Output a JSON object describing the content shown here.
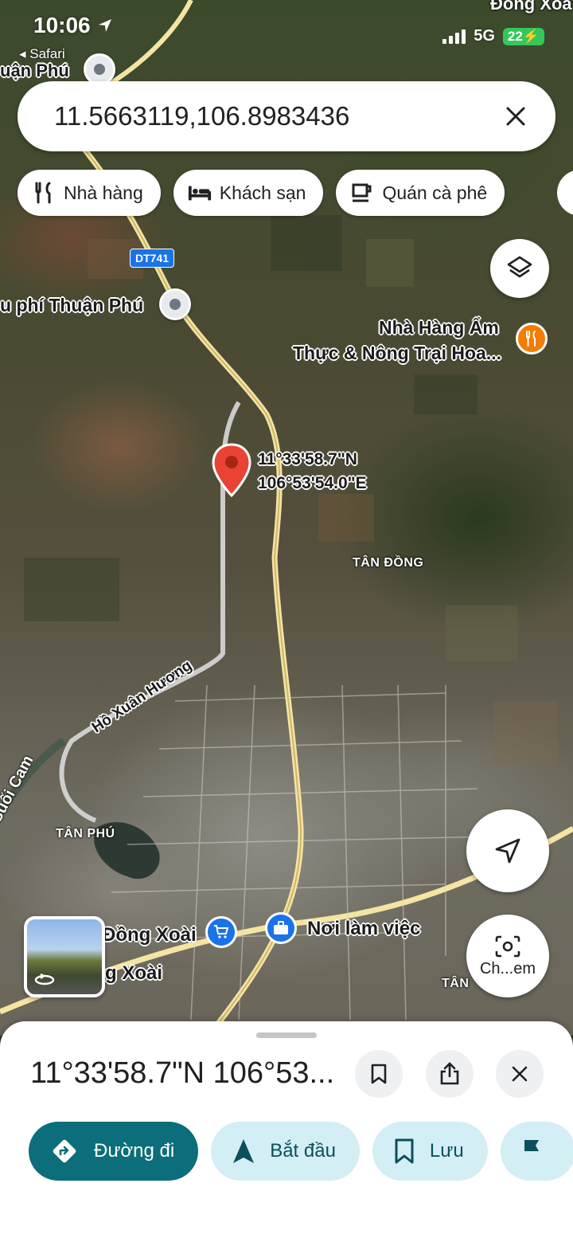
{
  "status_bar": {
    "time": "10:06",
    "back_app": "◂ Safari",
    "network": "5G",
    "battery": "22"
  },
  "search": {
    "value": "11.5663119,106.8983436"
  },
  "chips": [
    {
      "label": "Nhà hàng",
      "icon": "restaurant-icon"
    },
    {
      "label": "Khách sạn",
      "icon": "hotel-icon"
    },
    {
      "label": "Quán cà phê",
      "icon": "coffee-icon"
    }
  ],
  "map": {
    "labels": {
      "top_left_place": "uận Phú",
      "top_right_place": "Đồng Xoà",
      "toll": "u phí Thuận Phú",
      "restaurant_line1": "Nhà Hàng Ẩm",
      "restaurant_line2": "Thực & Nông Trại Hoa...",
      "road_shield": "DT741",
      "area_tan_dong": "TÂN ĐỒNG",
      "street_ho_xuan_huong": "Hồ Xuân Hương",
      "river": "Suối Cam",
      "area_tan_phu": "TÂN PHÚ",
      "dong_xoai_1": "Đồng Xoài",
      "dong_xoai_2": "g Xoài",
      "workplace": "Nơi làm việc",
      "area_tan_right": "TÂN"
    },
    "pin": {
      "lat": "11°33'58.7\"N",
      "lng": "106°53'54.0\"E"
    },
    "lens_label": "Ch...em"
  },
  "sheet": {
    "title": "11°33'58.7\"N 106°53...",
    "actions": [
      {
        "label": "Đường đi"
      },
      {
        "label": "Bắt đầu"
      },
      {
        "label": "Lưu"
      }
    ]
  },
  "colors": {
    "primary_action": "#0b6e7a",
    "secondary_action": "#d3eef5",
    "pin": "#ea4335"
  }
}
